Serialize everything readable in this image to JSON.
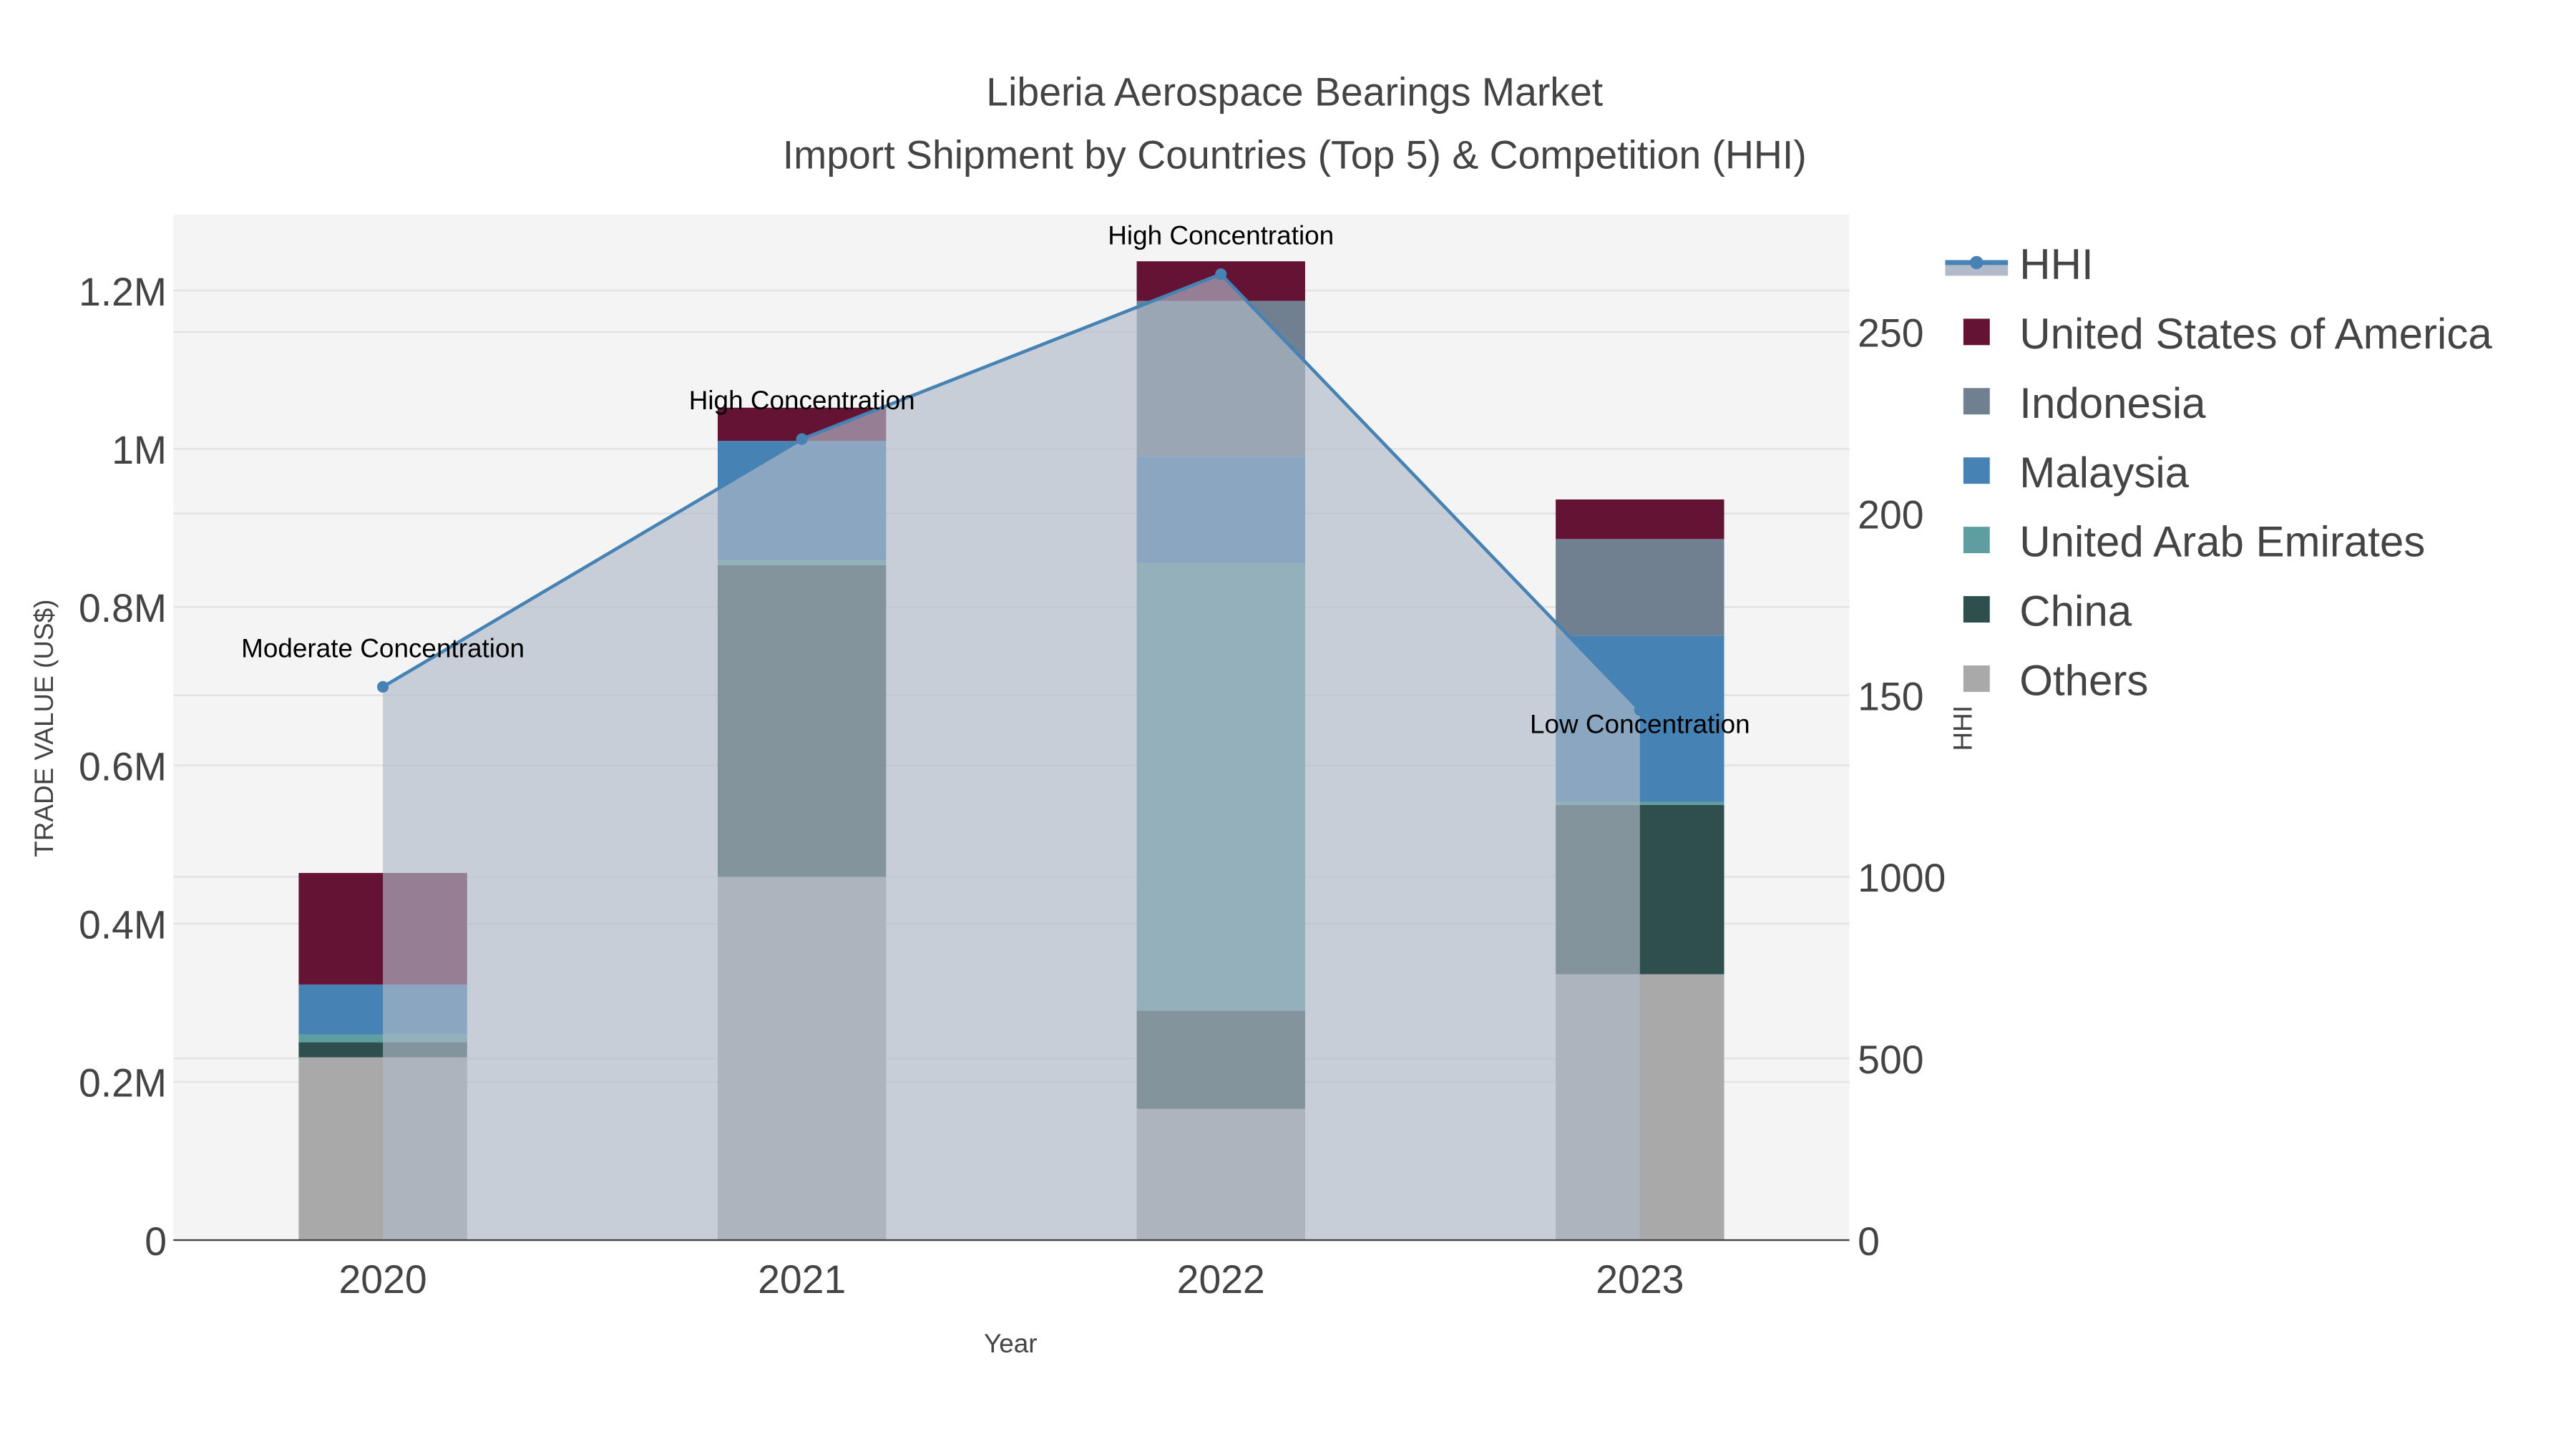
{
  "chart_data": {
    "type": "bar",
    "title": "Liberia Aerospace Bearings Market",
    "subtitle": "Import Shipment by Countries (Top 5) & Competition (HHI)",
    "xlabel": "Year",
    "ylabel": "TRADE VALUE (US$)",
    "y2label": "HHI",
    "barmode": "stack",
    "categories": [
      "2020",
      "2021",
      "2022",
      "2023"
    ],
    "ylim": [
      0,
      1300000
    ],
    "y2lim": [
      0,
      2818
    ],
    "yticks": [
      {
        "value": 0,
        "label": "0"
      },
      {
        "value": 200000,
        "label": "0.2M"
      },
      {
        "value": 400000,
        "label": "0.4M"
      },
      {
        "value": 600000,
        "label": "0.6M"
      },
      {
        "value": 800000,
        "label": "0.8M"
      },
      {
        "value": 1000000,
        "label": "1M"
      },
      {
        "value": 1200000,
        "label": "1.2M"
      }
    ],
    "y2ticks": [
      {
        "value": 0,
        "label": "0"
      },
      {
        "value": 500,
        "label": "500"
      },
      {
        "value": 1000,
        "label": "1000"
      },
      {
        "value": 1500,
        "label": "150"
      },
      {
        "value": 2000,
        "label": "200"
      },
      {
        "value": 2500,
        "label": "250"
      }
    ],
    "series": [
      {
        "name": "Others",
        "color": "#a9a9a9",
        "values": [
          231000,
          459000,
          166000,
          336000
        ]
      },
      {
        "name": "China",
        "color": "#2f4f4f",
        "values": [
          19000,
          394000,
          124000,
          214000
        ]
      },
      {
        "name": "United Arab Emirates",
        "color": "#5f9ea0",
        "values": [
          10000,
          6000,
          566000,
          4000
        ]
      },
      {
        "name": "Malaysia",
        "color": "#4682b4",
        "values": [
          63000,
          151000,
          134000,
          210000
        ]
      },
      {
        "name": "Indonesia",
        "color": "#708090",
        "values": [
          0,
          0,
          197000,
          122000
        ]
      },
      {
        "name": "United States of America",
        "color": "#641334",
        "values": [
          141000,
          42000,
          50000,
          50000
        ]
      }
    ],
    "hhi": {
      "name": "HHI",
      "color": "#4682b4",
      "fill": "#b0bac8",
      "values": [
        1523,
        2205,
        2659,
        1459
      ],
      "annotations": [
        "Moderate Concentration",
        "High Concentration",
        "High Concentration",
        "Low Concentration"
      ]
    },
    "legend_order": [
      "HHI",
      "United States of America",
      "Indonesia",
      "Malaysia",
      "United Arab Emirates",
      "China",
      "Others"
    ],
    "legend_position": "right",
    "grid": true
  }
}
